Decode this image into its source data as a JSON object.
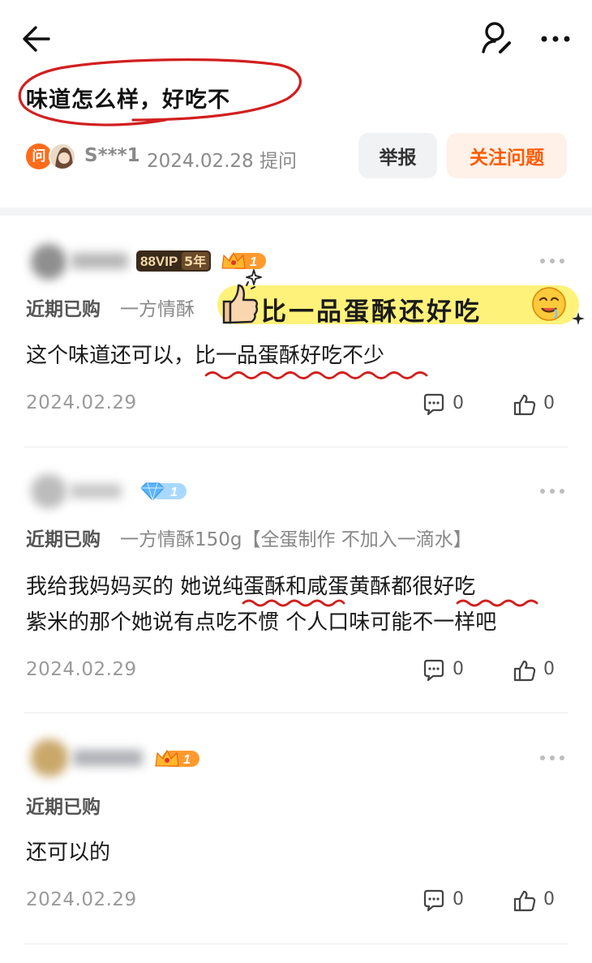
{
  "question": {
    "title": "味道怎么样，好吃不",
    "asker_name": "S***1",
    "asked_meta": "2024.02.28 提问",
    "ask_badge": "问",
    "report_label": "举报",
    "follow_label": "关注问题"
  },
  "answers": [
    {
      "vip_label": "88VIP",
      "vip_years": "5年",
      "level": "1",
      "purchase": "近期已购",
      "product": "一方情酥",
      "text": "这个味道还可以，比一品蛋酥好吃不少",
      "date": "2024.02.29",
      "comments": "0",
      "likes": "0",
      "sticker": "比一品蛋酥还好吃"
    },
    {
      "level": "1",
      "purchase": "近期已购",
      "product": "一方情酥150g【全蛋制作 不加入一滴水】",
      "text_line1": "我给我妈妈买的 她说纯蛋酥和咸蛋黄酥都很好吃",
      "text_line2": "紫米的那个她说有点吃不惯 个人口味可能不一样吧",
      "date": "2024.02.29",
      "comments": "0",
      "likes": "0"
    },
    {
      "level": "1",
      "purchase": "近期已购",
      "text": "还可以的",
      "date": "2024.02.29",
      "comments": "0",
      "likes": "0"
    }
  ],
  "colors": {
    "accent_orange": "#ff5a00",
    "sticker_yellow": "#fff27a",
    "annotation_red": "#d21f1f"
  },
  "icons": [
    "back-arrow-icon",
    "person-edit-icon",
    "more-icon",
    "comment-icon",
    "thumbs-up-icon",
    "diamond-icon",
    "crown-icon"
  ]
}
